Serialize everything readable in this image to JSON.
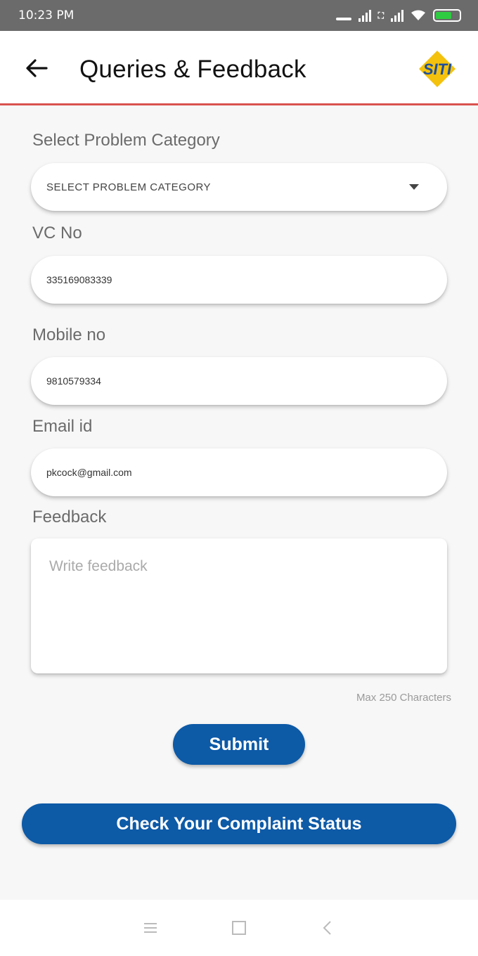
{
  "status_bar": {
    "time": "10:23 PM",
    "icons": [
      "signal-icon",
      "sim-icon",
      "signal-icon",
      "wifi-icon",
      "battery-icon"
    ],
    "battery_color": "#2ecc40"
  },
  "app_bar": {
    "title": "Queries & Feedback",
    "back_icon": "arrow-left-icon",
    "logo_text": "SITI",
    "accent_line_color": "#d9534f"
  },
  "form": {
    "category": {
      "label": "Select Problem Category",
      "value": "SELECT PROBLEM CATEGORY",
      "icon": "chevron-down-icon"
    },
    "vc_no": {
      "label": "VC No",
      "value": "335169083339"
    },
    "mobile": {
      "label": "Mobile no",
      "value": "9810579334"
    },
    "email": {
      "label": "Email id",
      "value": "pkcock@gmail.com"
    },
    "feedback": {
      "label": "Feedback",
      "placeholder": "Write feedback",
      "limit_note": "Max 250 Characters"
    }
  },
  "buttons": {
    "submit": "Submit",
    "check_status": "Check Your Complaint Status",
    "color": "#0d5aa7"
  },
  "nav_bar": {
    "icons": [
      "menu-icon",
      "home-square-icon",
      "back-chevron-icon"
    ]
  }
}
